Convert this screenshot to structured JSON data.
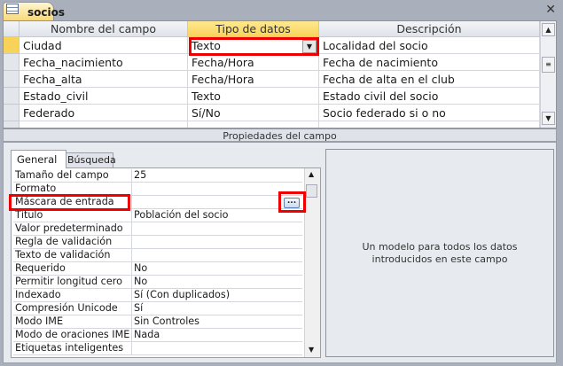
{
  "window": {
    "tab_title": "socios",
    "close_label": "✕"
  },
  "grid": {
    "headers": [
      "Nombre del campo",
      "Tipo de datos",
      "Descripción"
    ],
    "rows": [
      {
        "name": "Ciudad",
        "type": "Texto",
        "desc": "Localidad del socio"
      },
      {
        "name": "Fecha_nacimiento",
        "type": "Fecha/Hora",
        "desc": "Fecha de nacimiento"
      },
      {
        "name": "Fecha_alta",
        "type": "Fecha/Hora",
        "desc": "Fecha de alta en el club"
      },
      {
        "name": "Estado_civil",
        "type": "Texto",
        "desc": "Estado civil del socio"
      },
      {
        "name": "Federado",
        "type": "Sí/No",
        "desc": "Socio federado si o no"
      }
    ]
  },
  "properties": {
    "title": "Propiedades del campo",
    "tabs": [
      "General",
      "Búsqueda"
    ],
    "rows": [
      {
        "k": "Tamaño del campo",
        "v": "25"
      },
      {
        "k": "Formato",
        "v": ""
      },
      {
        "k": "Máscara de entrada",
        "v": ""
      },
      {
        "k": "Título",
        "v": "Población del socio"
      },
      {
        "k": "Valor predeterminado",
        "v": ""
      },
      {
        "k": "Regla de validación",
        "v": ""
      },
      {
        "k": "Texto de validación",
        "v": ""
      },
      {
        "k": "Requerido",
        "v": "No"
      },
      {
        "k": "Permitir longitud cero",
        "v": "No"
      },
      {
        "k": "Indexado",
        "v": "Sí (Con duplicados)"
      },
      {
        "k": "Compresión Unicode",
        "v": "Sí"
      },
      {
        "k": "Modo IME",
        "v": "Sin Controles"
      },
      {
        "k": "Modo de oraciones IME",
        "v": "Nada"
      },
      {
        "k": "Etiquetas inteligentes",
        "v": ""
      }
    ],
    "build_label": "...",
    "help": "Un modelo para todos los datos introducidos en este campo"
  }
}
